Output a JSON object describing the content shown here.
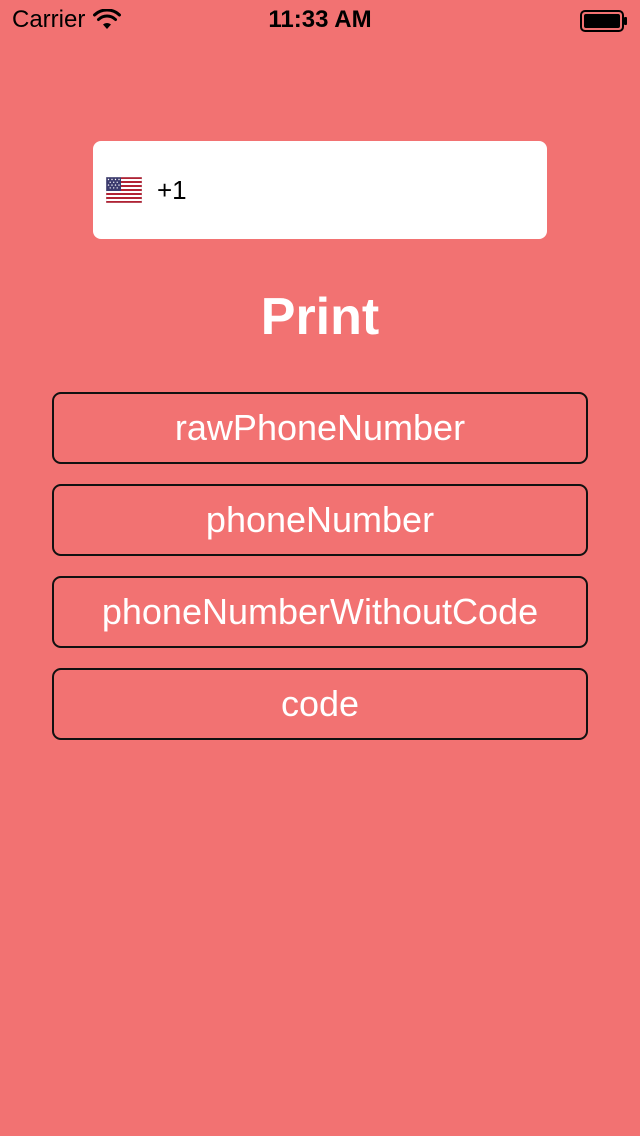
{
  "status_bar": {
    "carrier": "Carrier",
    "time": "11:33 AM",
    "wifi_icon": "wifi-icon",
    "battery_icon": "battery-full-icon"
  },
  "phone_input": {
    "flag_icon": "us-flag-icon",
    "country": "US",
    "value": "+1"
  },
  "title": "Print",
  "buttons": [
    {
      "label": "rawPhoneNumber"
    },
    {
      "label": "phoneNumber"
    },
    {
      "label": "phoneNumberWithoutCode"
    },
    {
      "label": "code"
    }
  ],
  "colors": {
    "background": "#F27272",
    "button_border": "#111111",
    "text_light": "#FFFFFF",
    "field_background": "#FFFFFF"
  }
}
